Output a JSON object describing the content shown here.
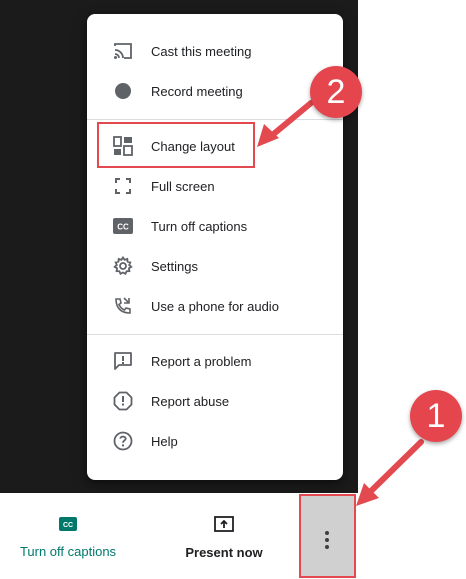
{
  "menu": {
    "items": [
      {
        "label": "Cast this meeting",
        "icon": "cast-icon"
      },
      {
        "label": "Record meeting",
        "icon": "record-icon"
      },
      {
        "label": "Change layout",
        "icon": "layout-icon"
      },
      {
        "label": "Full screen",
        "icon": "fullscreen-icon"
      },
      {
        "label": "Turn off captions",
        "icon": "captions-icon"
      },
      {
        "label": "Settings",
        "icon": "gear-icon"
      },
      {
        "label": "Use a phone for audio",
        "icon": "phone-audio-icon"
      },
      {
        "label": "Report a problem",
        "icon": "report-problem-icon"
      },
      {
        "label": "Report abuse",
        "icon": "report-abuse-icon"
      },
      {
        "label": "Help",
        "icon": "help-icon"
      }
    ]
  },
  "bottom_bar": {
    "captions_label": "Turn off captions",
    "present_label": "Present now"
  },
  "annotations": {
    "step1": "1",
    "step2": "2"
  },
  "colors": {
    "accent_teal": "#00796b",
    "annotation_red": "#e34a4f"
  }
}
